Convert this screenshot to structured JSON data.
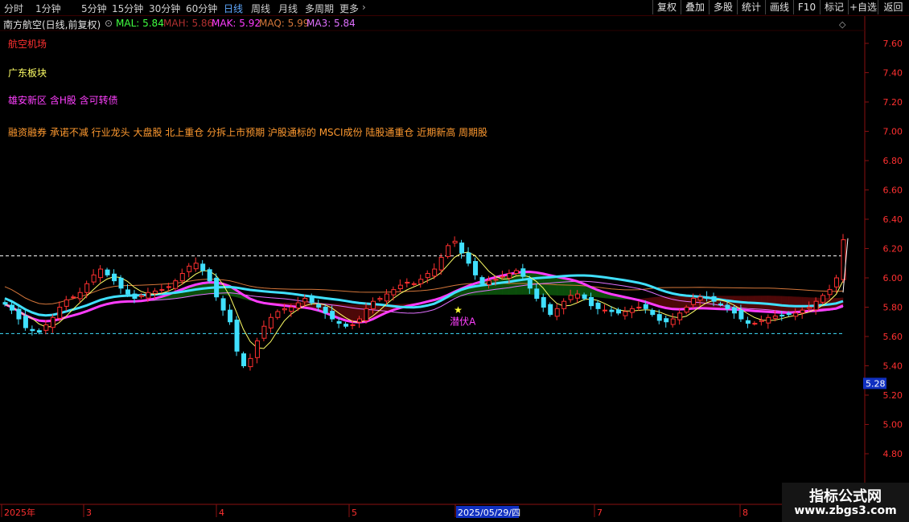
{
  "toolbar": {
    "periods": [
      "分时",
      "1分钟",
      "5分钟",
      "15分钟",
      "30分钟",
      "60分钟",
      "日线",
      "周线",
      "月线",
      "多周期",
      "更多"
    ],
    "active_period": "日线",
    "buttons": [
      "复权",
      "叠加",
      "多股",
      "统计",
      "画线",
      "F10",
      "+自选",
      "返回"
    ]
  },
  "info": {
    "title": "南方航空(日线,前复权)",
    "mal": "MAL: 5.84",
    "mah": "MAH: 5.86",
    "mak": "MAK: 5.92",
    "maq": "MAQ: 5.99",
    "ma3": "MA3: 5.84"
  },
  "tags": {
    "industry": "航空机场",
    "region": "广东板块",
    "concepts": "雄安新区 含H股 含可转债",
    "styles": "融资融券 承诺不减 行业龙头 大盘股 北上重仓 分拆上市预期 沪股通标的 MSCI成份 陆股通重仓 近期新高 周期股"
  },
  "signal_label": "潜伏A",
  "price_marker": "5.28",
  "brand": {
    "name": "指标公式网",
    "url": "www.zbgs3.com"
  },
  "colors": {
    "up": "#ff3030",
    "down": "#40e0ff",
    "mal": "#ffff66",
    "mah": "#ff6a6a",
    "mak": "#ff3cff",
    "maq": "#d4763a",
    "ma3": "#e070ff",
    "band_bear": "#5a0a0a",
    "band_bull": "#0e5a0e"
  },
  "chart_data": {
    "type": "candlestick",
    "y_ticks": [
      "7.60",
      "7.40",
      "7.20",
      "7.00",
      "6.80",
      "6.60",
      "6.40",
      "6.20",
      "6.00",
      "5.80",
      "5.60",
      "5.40",
      "5.20",
      "5.00",
      "4.80"
    ],
    "ylim": [
      4.64,
      7.72
    ],
    "x_labels": [
      "2025年",
      "3",
      "4",
      "5",
      "2025/05/29/四",
      "7",
      "8"
    ],
    "dashed_levels": [
      6.15,
      5.62
    ],
    "closes": [
      5.82,
      5.78,
      5.72,
      5.66,
      5.64,
      5.63,
      5.68,
      5.73,
      5.8,
      5.85,
      5.87,
      5.9,
      5.96,
      6.02,
      6.06,
      6.02,
      5.98,
      5.93,
      5.89,
      5.86,
      5.88,
      5.9,
      5.91,
      5.92,
      5.94,
      5.98,
      6.03,
      6.08,
      6.1,
      6.05,
      5.98,
      5.87,
      5.78,
      5.7,
      5.5,
      5.4,
      5.45,
      5.57,
      5.67,
      5.73,
      5.77,
      5.79,
      5.8,
      5.83,
      5.86,
      5.83,
      5.8,
      5.76,
      5.72,
      5.69,
      5.67,
      5.68,
      5.72,
      5.79,
      5.84,
      5.86,
      5.89,
      5.92,
      5.95,
      5.97,
      5.96,
      5.99,
      6.03,
      6.06,
      6.14,
      6.22,
      6.25,
      6.17,
      6.1,
      6.02,
      5.96,
      5.98,
      5.99,
      6.01,
      6.03,
      6.05,
      6.01,
      5.93,
      5.86,
      5.8,
      5.75,
      5.79,
      5.84,
      5.88,
      5.89,
      5.86,
      5.81,
      5.79,
      5.78,
      5.77,
      5.76,
      5.77,
      5.79,
      5.8,
      5.79,
      5.75,
      5.71,
      5.7,
      5.72,
      5.76,
      5.8,
      5.86,
      5.87,
      5.86,
      5.84,
      5.82,
      5.79,
      5.76,
      5.72,
      5.69,
      5.69,
      5.71,
      5.73,
      5.74,
      5.74,
      5.75,
      5.76,
      5.78,
      5.8,
      5.84,
      5.88,
      5.92,
      6.0,
      6.26
    ]
  }
}
